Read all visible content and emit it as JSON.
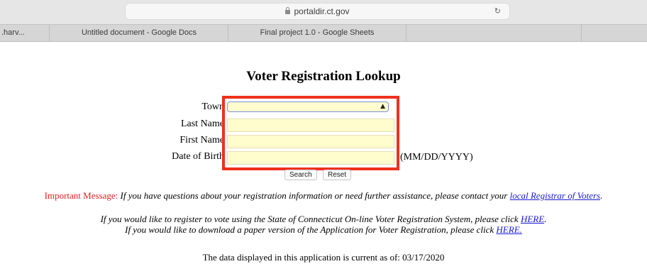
{
  "browser": {
    "url": "portaldir.ct.gov",
    "tabs": [
      ".harv...",
      "Untitled document - Google Docs",
      "Final project 1.0 - Google Sheets",
      "",
      ""
    ]
  },
  "page": {
    "title": "Voter Registration Lookup",
    "form": {
      "town_label": "Town",
      "town_value": "",
      "last_name_label": "Last Name",
      "last_name_value": "",
      "first_name_label": "First Name",
      "first_name_value": "",
      "dob_label": "Date of Birth",
      "dob_value": "",
      "dob_format": "(MM/DD/YYYY)",
      "search_button": "Search",
      "reset_button": "Reset"
    },
    "important": {
      "label": "Important Message:",
      "text": "If you have questions about your registration information or need further assistance, please contact your",
      "link": "local Registrar of Voters",
      "end": "."
    },
    "register": {
      "online_text": "If you would like to register to vote using the State of Connecticut On-line Voter Registration System, please click",
      "online_link": "HERE",
      "online_end": ".",
      "paper_text": "If you would like to download a paper version of the Application for Voter Registration, please click",
      "paper_link": "HERE.",
      "paper_end": ""
    },
    "data_current": "The data displayed in this application is current as of: 03/17/2020"
  },
  "colors": {
    "highlight": "#f0301c",
    "field_background": "#fffccd",
    "important_label": "#e02020",
    "link": "#1a1ad6"
  }
}
